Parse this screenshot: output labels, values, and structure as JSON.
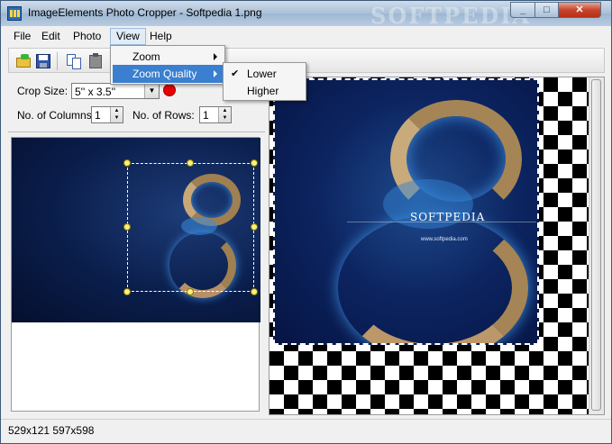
{
  "window": {
    "title": "ImageElements Photo Cropper - Softpedia 1.png",
    "watermark": "SOFTPEDIA"
  },
  "menubar": {
    "items": [
      "File",
      "Edit",
      "Photo",
      "View",
      "Help"
    ]
  },
  "view_menu": {
    "items": [
      "Zoom",
      "Zoom Quality"
    ],
    "submenu": [
      "Lower",
      "Higher"
    ],
    "checked": "Lower"
  },
  "crop": {
    "size_label": "Crop Size:",
    "size_value": "5'' x 3.5''",
    "columns_label": "No. of Columns:",
    "columns_value": "1",
    "rows_label": "No. of Rows:",
    "rows_value": "1"
  },
  "image_overlay": {
    "brand": "SOFTPEDIA",
    "url": "www.softpedia.com"
  },
  "status": {
    "text": "529x121 597x598"
  },
  "colors": {
    "selection": "#3a7fd0",
    "crop_indicator": "#e60000"
  }
}
